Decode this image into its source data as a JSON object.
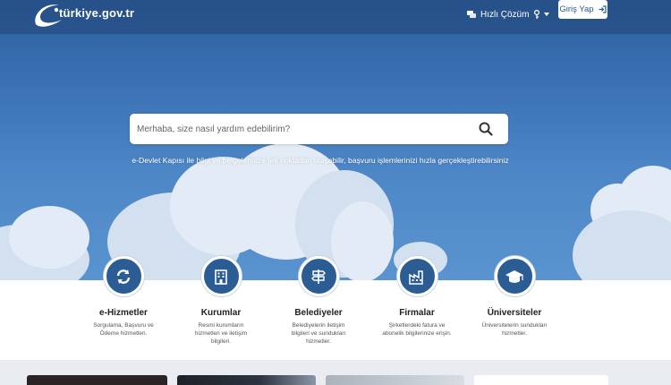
{
  "header": {
    "logo_text": "türkiye.gov.tr",
    "quick_help_label": "Hızlı Çözüm",
    "login_label": "Giriş Yap"
  },
  "search": {
    "placeholder": "Merhaba, size nasıl yardım edebilirim?"
  },
  "hero": {
    "subtitle": "e-Devlet Kapısı ile bilgi ve belgelerinize tek noktadan ulaşabilir, başvuru işlemlerinizi hızla gerçekleştirebilirsiniz"
  },
  "categories": [
    {
      "title": "e-Hizmetler",
      "desc": "Sorgulama, Başvuru ve Ödeme hizmetleri.",
      "icon": "refresh-icon"
    },
    {
      "title": "Kurumlar",
      "desc": "Resmi kurumların hizmetleri ve iletişim bilgileri.",
      "icon": "building-icon"
    },
    {
      "title": "Belediyeler",
      "desc": "Belediyelerin iletişim bilgileri ve sundukları hizmetler.",
      "icon": "signpost-icon"
    },
    {
      "title": "Firmalar",
      "desc": "Şirketlerdeki fatura ve abonelik bilgilerinize erişin.",
      "icon": "factory-icon"
    },
    {
      "title": "Üniversiteler",
      "desc": "Üniversitelerin sundukları hizmetler.",
      "icon": "graduation-cap-icon"
    }
  ],
  "colors": {
    "brand_blue": "#2c5c94",
    "hero_top": "#2d5f9c",
    "hero_bottom": "#5a94cf",
    "section_bg": "#e9edf2"
  }
}
